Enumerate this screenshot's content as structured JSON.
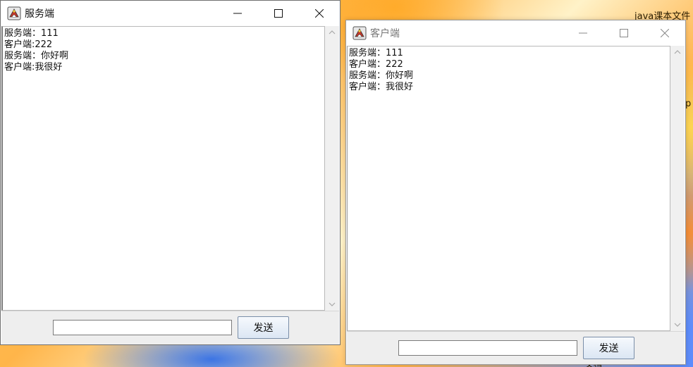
{
  "desktop": {
    "fragment_1": "java课本文件",
    "fragment_2": "p",
    "fragment_3": "文档"
  },
  "server_window": {
    "title": "服务端",
    "messages": [
      "服务端：111",
      "客户端:222",
      "服务端：你好啊",
      "客户端:我很好"
    ],
    "input_value": "",
    "send_label": "发送"
  },
  "client_window": {
    "title": "客户端",
    "messages": [
      "服务端：111",
      "客户端：222",
      "服务端：你好啊",
      "客户端：我很好"
    ],
    "input_value": "",
    "send_label": "发送"
  },
  "colors": {
    "accent_button_top": "#f6f9fd",
    "accent_button_bottom": "#dbe6f3",
    "window_chrome": "#eeeeee"
  }
}
